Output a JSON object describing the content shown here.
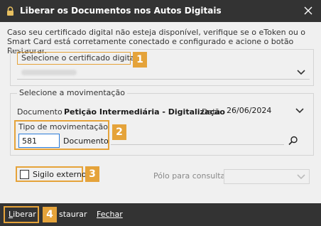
{
  "window": {
    "title": "Liberar os Documentos nos Autos Digitais",
    "close_icon": "close-icon",
    "app_icon": "padlock-app-icon"
  },
  "info_text": "Caso seu certificado digital não esteja disponível, verifique se o eToken ou o Smart Card está corretamente conectado e configurado e acione o botão Restaurar.",
  "certificate": {
    "label": "Selecione o certificado digital",
    "selected_value_obscured": true
  },
  "movement": {
    "legend": "Selecione a movimentação",
    "document_label": "Documento",
    "document_value": "Petição Intermediária - Digitalização",
    "date_label": "Data",
    "date_value": "26/06/2024",
    "tipo_label": "Tipo de movimentação",
    "tipo_code": "581",
    "tipo_description": "Documento",
    "search_icon": "search-icon"
  },
  "options": {
    "sigilo_label": "Sigilo externo",
    "sigilo_checked": false,
    "polo_label": "Pólo para consulta",
    "polo_value": ""
  },
  "footer": {
    "liberar_mnemonic": "L",
    "liberar_rest": "iberar",
    "restaurar_visible": "staurar",
    "fechar_mnemonic": "F",
    "fechar_rest": "echar"
  },
  "badges": [
    "1",
    "2",
    "3",
    "4"
  ],
  "colors": {
    "highlight": "#e5a33a",
    "titlebar": "#333333",
    "focus_border": "#2b7bd8"
  }
}
